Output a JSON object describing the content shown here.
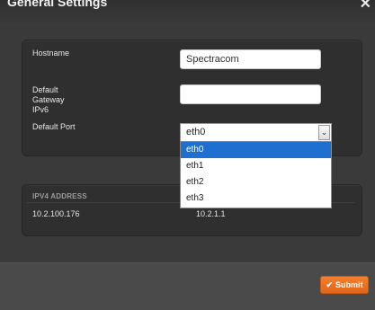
{
  "dialog": {
    "title": "General Settings",
    "close_icon": "close-icon",
    "close_glyph": "✕"
  },
  "form": {
    "hostname_label": "Hostname",
    "hostname_value": "Spectracom",
    "gateway_label": "Default Gateway IPv6",
    "gateway_value": "",
    "port_label": "Default Port",
    "port_value": "eth0",
    "port_options": [
      "eth0",
      "eth1",
      "eth2",
      "eth3"
    ],
    "port_selected_option": "eth0"
  },
  "ipv4": {
    "header": "IPV4 ADDRESS",
    "address": "10.2.100.176",
    "gateway": "10.2.1.1"
  },
  "footer": {
    "submit_label": "Submit",
    "submit_icon": "check-icon",
    "submit_color": "#f47f2f"
  }
}
